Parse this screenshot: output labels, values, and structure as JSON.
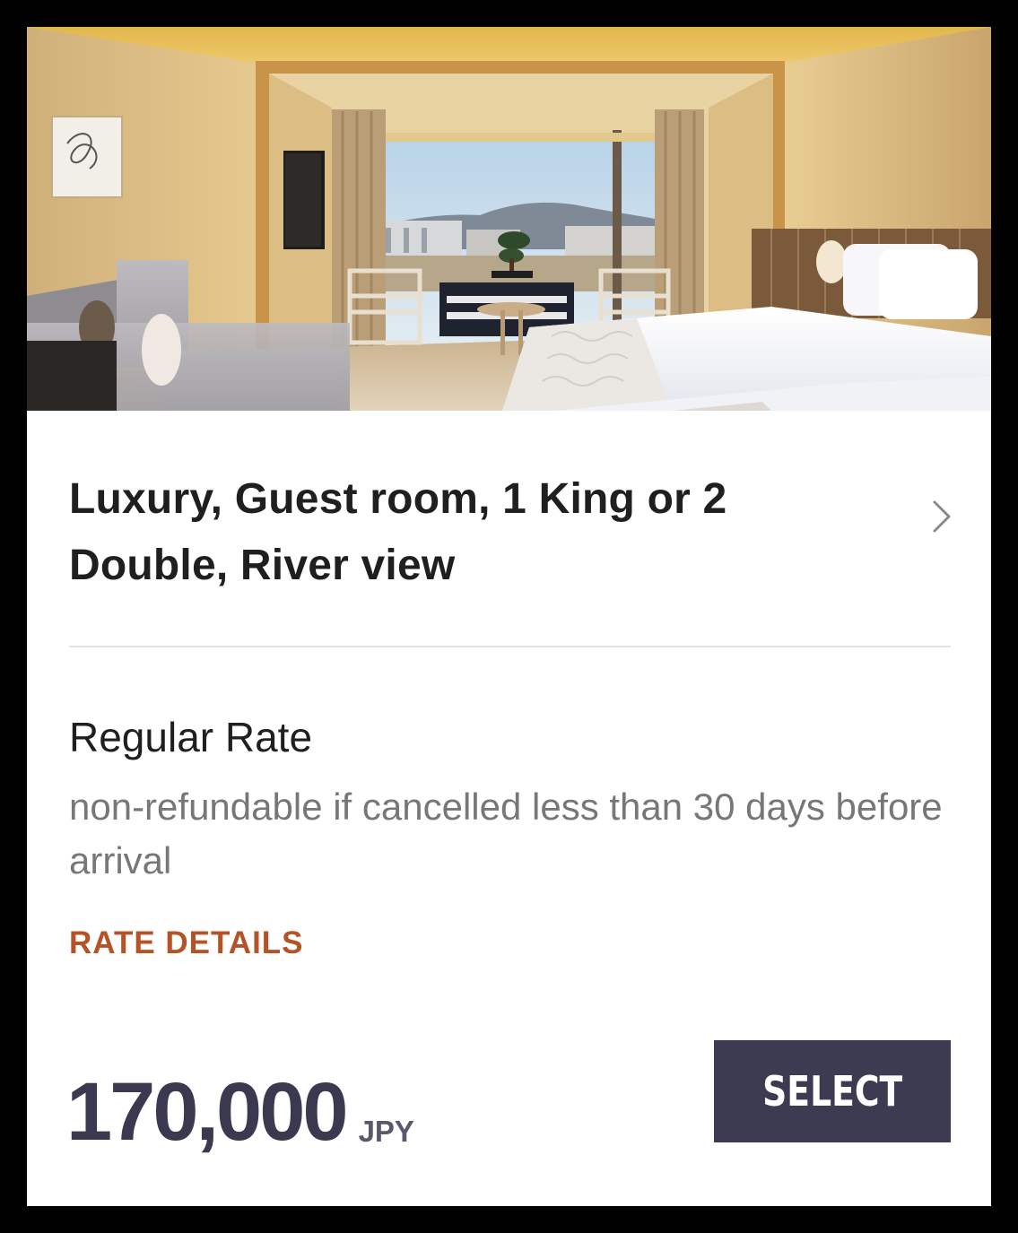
{
  "room": {
    "image_alt": "Guest room with river view",
    "title": "Luxury, Guest room, 1 King or 2 Double, River view",
    "details_icon": "chevron-right-icon"
  },
  "rate": {
    "name": "Regular Rate",
    "description": "non-refundable if cancelled less than 30 days before arrival",
    "details_link": "RATE DETAILS"
  },
  "price": {
    "amount": "170,000",
    "currency": "JPY"
  },
  "actions": {
    "select_label": "SELECT"
  },
  "colors": {
    "accent": "#b55327",
    "button": "#3d3b52",
    "price": "#3b3950",
    "muted_text": "#777777",
    "divider": "#e4e4e4"
  }
}
